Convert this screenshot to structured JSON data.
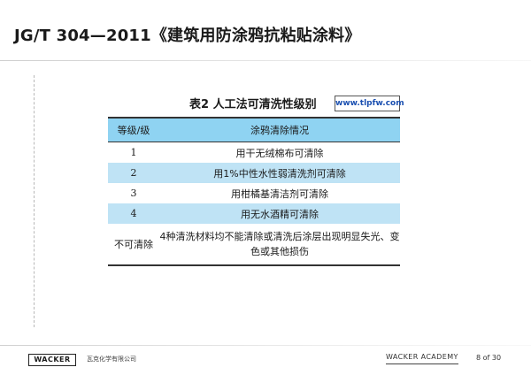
{
  "slide": {
    "title": "JG/T 304—2011《建筑用防涂鸦抗粘贴涂料》"
  },
  "table": {
    "caption": "表2  人工法可清洗性级别",
    "watermark": "www.tlpfw.com",
    "headers": [
      "等级/级",
      "涂鸦清除情况"
    ],
    "rows": [
      {
        "grade": "1",
        "desc": "用干无绒棉布可清除"
      },
      {
        "grade": "2",
        "desc": "用1%中性水性弱清洗剂可清除"
      },
      {
        "grade": "3",
        "desc": "用柑橘基清洁剂可清除"
      },
      {
        "grade": "4",
        "desc": "用无水酒精可清除"
      },
      {
        "grade": "不可清除",
        "desc": "4种清洗材料均不能清除或清洗后涂层出现明显失光、变色或其他损伤"
      }
    ]
  },
  "footer": {
    "logo": "WACKER",
    "company": "瓦克化学有限公司",
    "academy": "WACKER ACADEMY",
    "page": "8 of 30"
  },
  "colors": {
    "header_bg": "#8fd3f2",
    "row_alt_bg": "#bfe3f5",
    "watermark_text": "#1a4fb0"
  }
}
